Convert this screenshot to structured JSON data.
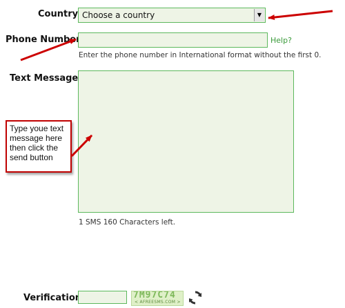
{
  "form": {
    "country_label": "Country",
    "country_value": "Choose a country",
    "phone_label": "Phone Number",
    "phone_value": "",
    "help_link": "Help?",
    "phone_hint": "Enter the phone number in International format without the first 0.",
    "message_label": "Text Message",
    "message_value": "",
    "sms_counter": "1 SMS 160 Characters left.",
    "verification_label": "Verification",
    "verification_value": "",
    "captcha_code": "7M97C74",
    "captcha_brand": "< AFREESMS.COM >"
  },
  "annotation": {
    "callout_text": "Type youe text message here then click the send button"
  },
  "icons": {
    "refresh": "refresh-icon",
    "dropdown": "dropdown-arrow-icon"
  },
  "colors": {
    "field_bg": "#eef4e6",
    "field_border": "#5cb85c",
    "annotation_red": "#cc0000",
    "link_green": "#3a9a3a"
  }
}
